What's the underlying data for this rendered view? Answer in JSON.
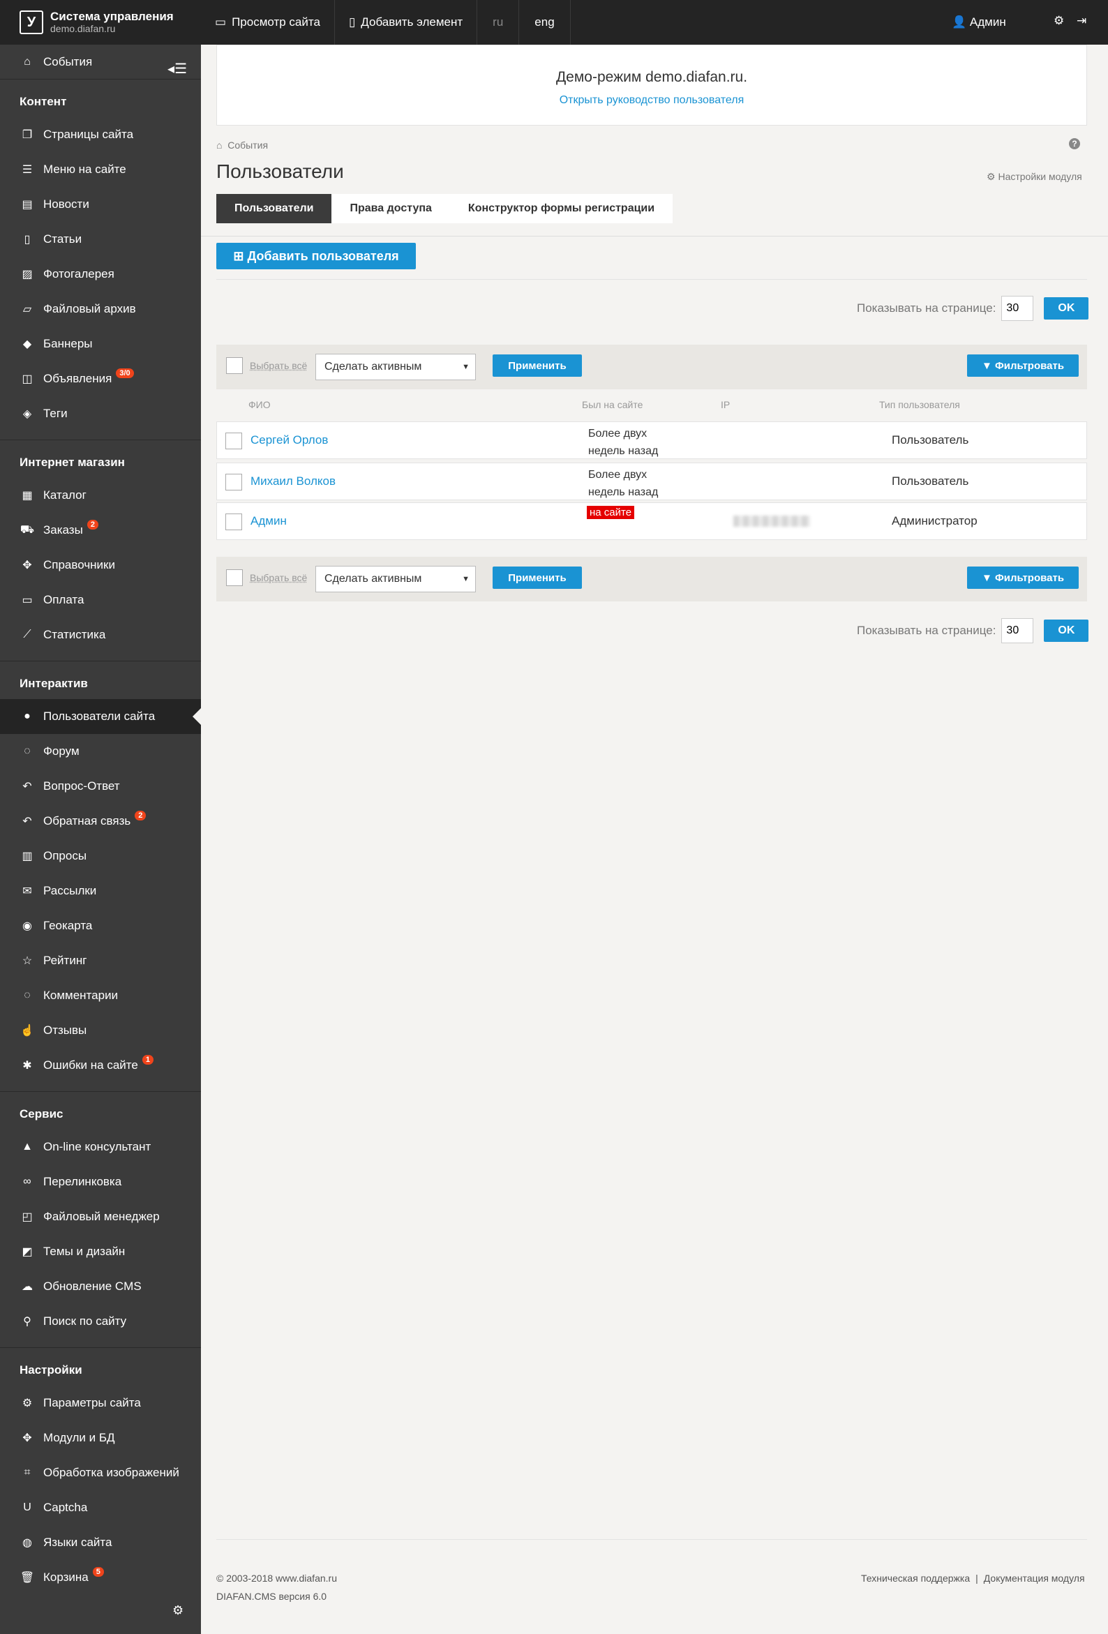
{
  "brand": {
    "logo": "У",
    "title": "Система управления",
    "subtitle": "demo.diafan.ru"
  },
  "topbar": {
    "view_site": "Просмотр сайта",
    "add_element": "Добавить элемент",
    "lang_ru": "ru",
    "lang_eng": "eng",
    "admin": "Админ"
  },
  "sidebar": {
    "events": "События",
    "sections": [
      {
        "title": "Контент",
        "items": [
          {
            "label": "Страницы сайта",
            "icon": "pages-icon",
            "glyph": "❐"
          },
          {
            "label": "Меню на сайте",
            "icon": "menu-icon",
            "glyph": "☰"
          },
          {
            "label": "Новости",
            "icon": "news-icon",
            "glyph": "▤"
          },
          {
            "label": "Статьи",
            "icon": "article-icon",
            "glyph": "▯"
          },
          {
            "label": "Фотогалерея",
            "icon": "photo-icon",
            "glyph": "▨"
          },
          {
            "label": "Файловый архив",
            "icon": "folder-icon",
            "glyph": "▱"
          },
          {
            "label": "Баннеры",
            "icon": "banner-icon",
            "glyph": "◆"
          },
          {
            "label": "Объявления",
            "icon": "ads-icon",
            "glyph": "◫",
            "badge": "3/0"
          },
          {
            "label": "Теги",
            "icon": "tag-icon",
            "glyph": "◈"
          }
        ]
      },
      {
        "title": "Интернет магазин",
        "items": [
          {
            "label": "Каталог",
            "icon": "catalog-icon",
            "glyph": "▦"
          },
          {
            "label": "Заказы",
            "icon": "cart-icon",
            "glyph": "⛟",
            "badge": "2"
          },
          {
            "label": "Справочники",
            "icon": "puzzle-icon",
            "glyph": "✥"
          },
          {
            "label": "Оплата",
            "icon": "card-icon",
            "glyph": "▭"
          },
          {
            "label": "Статистика",
            "icon": "chart-icon",
            "glyph": "⟋"
          }
        ]
      },
      {
        "title": "Интерактив",
        "items": [
          {
            "label": "Пользователи сайта",
            "icon": "users-icon",
            "glyph": "●",
            "active": true
          },
          {
            "label": "Форум",
            "icon": "forum-icon",
            "glyph": "◌"
          },
          {
            "label": "Вопрос-Ответ",
            "icon": "reply-icon",
            "glyph": "↶"
          },
          {
            "label": "Обратная связь",
            "icon": "feedback-icon",
            "glyph": "↶",
            "badge": "2"
          },
          {
            "label": "Опросы",
            "icon": "poll-icon",
            "glyph": "▥"
          },
          {
            "label": "Рассылки",
            "icon": "mail-icon",
            "glyph": "✉"
          },
          {
            "label": "Геокарта",
            "icon": "map-marker-icon",
            "glyph": "◉"
          },
          {
            "label": "Рейтинг",
            "icon": "star-icon",
            "glyph": "☆"
          },
          {
            "label": "Комментарии",
            "icon": "comment-icon",
            "glyph": "◌"
          },
          {
            "label": "Отзывы",
            "icon": "thumbs-up-icon",
            "glyph": "☝"
          },
          {
            "label": "Ошибки на сайте",
            "icon": "bug-icon",
            "glyph": "✱",
            "badge": "1"
          }
        ]
      },
      {
        "title": "Сервис",
        "items": [
          {
            "label": "On-line консультант",
            "icon": "graduation-icon",
            "glyph": "▲"
          },
          {
            "label": "Перелинковка",
            "icon": "link-icon",
            "glyph": "∞"
          },
          {
            "label": "Файловый менеджер",
            "icon": "file-code-icon",
            "glyph": "◰"
          },
          {
            "label": "Темы и дизайн",
            "icon": "theme-icon",
            "glyph": "◩"
          },
          {
            "label": "Обновление CMS",
            "icon": "cloud-download-icon",
            "glyph": "☁"
          },
          {
            "label": "Поиск по сайту",
            "icon": "search-icon",
            "glyph": "⚲"
          }
        ]
      },
      {
        "title": "Настройки",
        "items": [
          {
            "label": "Параметры сайта",
            "icon": "cogs-icon",
            "glyph": "⚙"
          },
          {
            "label": "Модули и БД",
            "icon": "puzzle-icon",
            "glyph": "✥"
          },
          {
            "label": "Обработка изображений",
            "icon": "crop-icon",
            "glyph": "⌗"
          },
          {
            "label": "Captcha",
            "icon": "underline-icon",
            "glyph": "U"
          },
          {
            "label": "Языки сайта",
            "icon": "globe-icon",
            "glyph": "◍"
          },
          {
            "label": "Корзина",
            "icon": "trash-icon",
            "glyph": "🗑",
            "badge": "5"
          }
        ]
      }
    ]
  },
  "demo": {
    "title": "Демо-режим demo.diafan.ru.",
    "link": "Открыть руководство пользователя"
  },
  "breadcrumb": "События",
  "page_title": "Пользователи",
  "module_settings": "Настройки модуля",
  "tabs": [
    "Пользователи",
    "Права доступа",
    "Конструктор формы регистрации"
  ],
  "add_user": "Добавить пользователя",
  "perpage": {
    "label": "Показывать на странице:",
    "value": "30",
    "ok": "OK"
  },
  "actions": {
    "select_all": "Выбрать всё",
    "action": "Сделать активным",
    "apply": "Применить",
    "filter": "Фильтровать"
  },
  "table": {
    "headers": {
      "name": "ФИО",
      "last_visit": "Был на сайте",
      "ip": "IP",
      "type": "Тип пользователя"
    },
    "rows": [
      {
        "name": "Сергей Орлов",
        "last_visit": "Более двух недель назад",
        "type": "Пользователь"
      },
      {
        "name": "Михаил Волков",
        "last_visit": "Более двух недель назад",
        "type": "Пользователь"
      },
      {
        "name": "Админ",
        "online": "на сайте",
        "type": "Администратор"
      }
    ]
  },
  "footer": {
    "copyright": "© 2003-2018 www.diafan.ru",
    "version": "DIAFAN.CMS версия 6.0",
    "support": "Техническая поддержка",
    "docs": "Документация модуля"
  },
  "colors": {
    "accent": "#1a93d3",
    "sidebar": "#3b3b3b",
    "topbar": "#242424",
    "badge": "#f0441b",
    "online": "#e50000"
  }
}
